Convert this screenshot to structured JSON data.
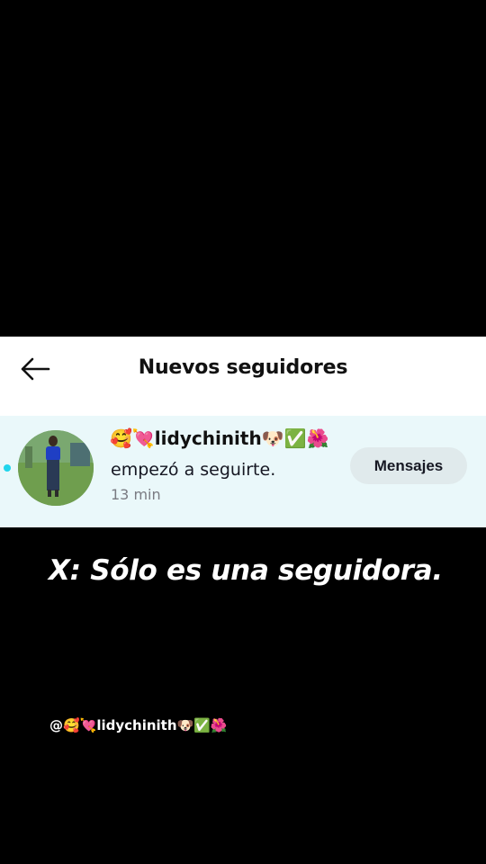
{
  "header": {
    "back_icon": "arrow-left-icon",
    "title": "Nuevos seguidores"
  },
  "notification": {
    "unread": true,
    "username": "🥰💘lidychinith🐶✅🌺",
    "action": "empezó a seguirte.",
    "time": "13 min",
    "button_label": "Mensajes"
  },
  "caption": {
    "text": "X: Sólo es una seguidora.",
    "emoji": "😏"
  },
  "mention": {
    "text": "@🥰💘lidychinith🐶✅🌺"
  },
  "colors": {
    "background": "#000000",
    "header_bg": "#ffffff",
    "row_bg": "#eaf8fa",
    "unread_dot": "#20d5ec",
    "button_bg": "#e0eaec"
  }
}
